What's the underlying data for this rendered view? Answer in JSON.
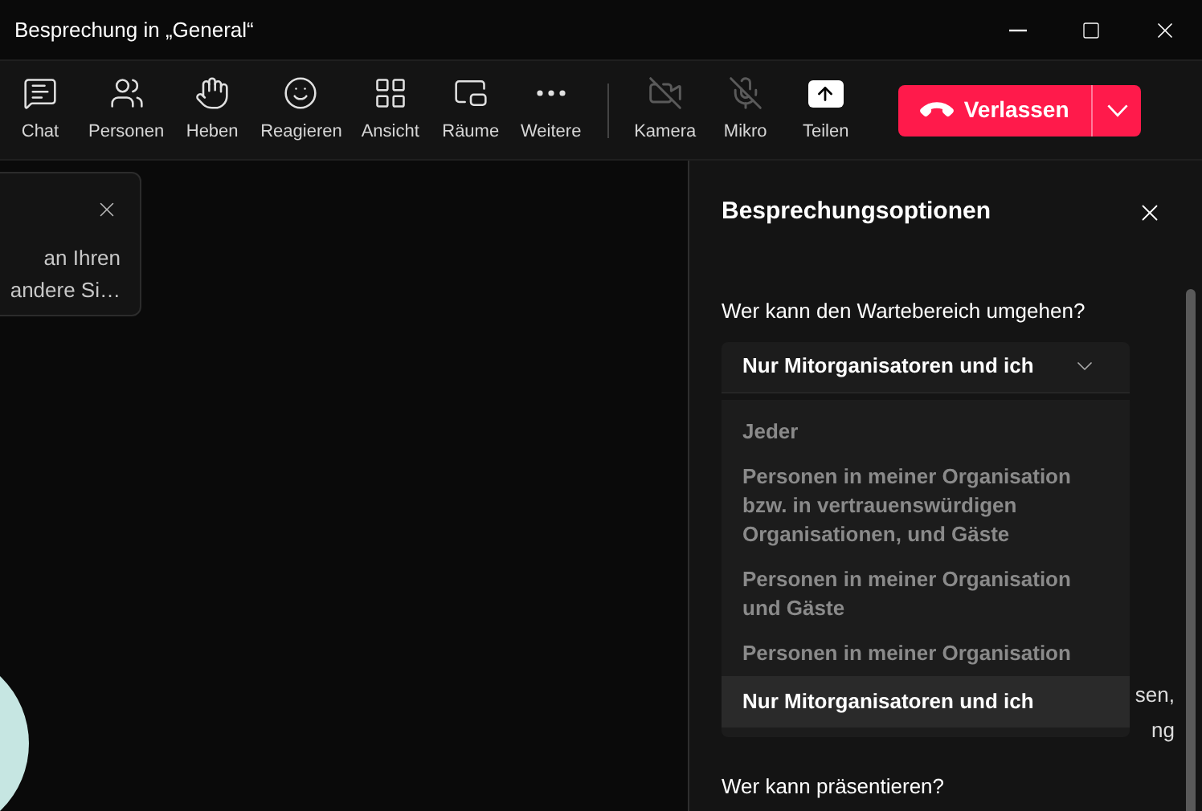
{
  "window": {
    "title": "Besprechung in „General“"
  },
  "toolbar": {
    "items": [
      {
        "kind": "action",
        "label": "Chat"
      },
      {
        "kind": "action",
        "label": "Personen"
      },
      {
        "kind": "action",
        "label": "Heben"
      },
      {
        "kind": "action",
        "label": "Reagieren"
      },
      {
        "kind": "action",
        "label": "Ansicht"
      },
      {
        "kind": "action",
        "label": "Räume"
      },
      {
        "kind": "action",
        "label": "Weitere"
      },
      {
        "kind": "device",
        "label": "Kamera",
        "on": false
      },
      {
        "kind": "device",
        "label": "Mikro",
        "on": false
      },
      {
        "kind": "share",
        "label": "Teilen"
      }
    ],
    "leave_button": {
      "label": "Verlassen"
    }
  },
  "notification": {
    "lines": [
      "an Ihren",
      "andere Si…"
    ]
  },
  "panel": {
    "title": "Besprechungsoptionen",
    "lobby": {
      "question": "Wer kann den Wartebereich umgehen?",
      "value": "Nur Mitorganisatoren und ich",
      "expanded": true,
      "options": [
        {
          "label": "Jeder",
          "selected": false
        },
        {
          "label": "Personen in meiner Organisation bzw. in vertrauenswürdigen Organisationen, und Gäste",
          "selected": false
        },
        {
          "label": "Personen in meiner Organisation und Gäste",
          "selected": false
        },
        {
          "label": "Personen in meiner Organisation",
          "selected": false
        },
        {
          "label": "Nur Mitorganisatoren und ich",
          "selected": true
        }
      ]
    },
    "hidden_text_fragments": [
      "sen,",
      "ng"
    ],
    "presenters": {
      "question": "Wer kann präsentieren?"
    }
  }
}
